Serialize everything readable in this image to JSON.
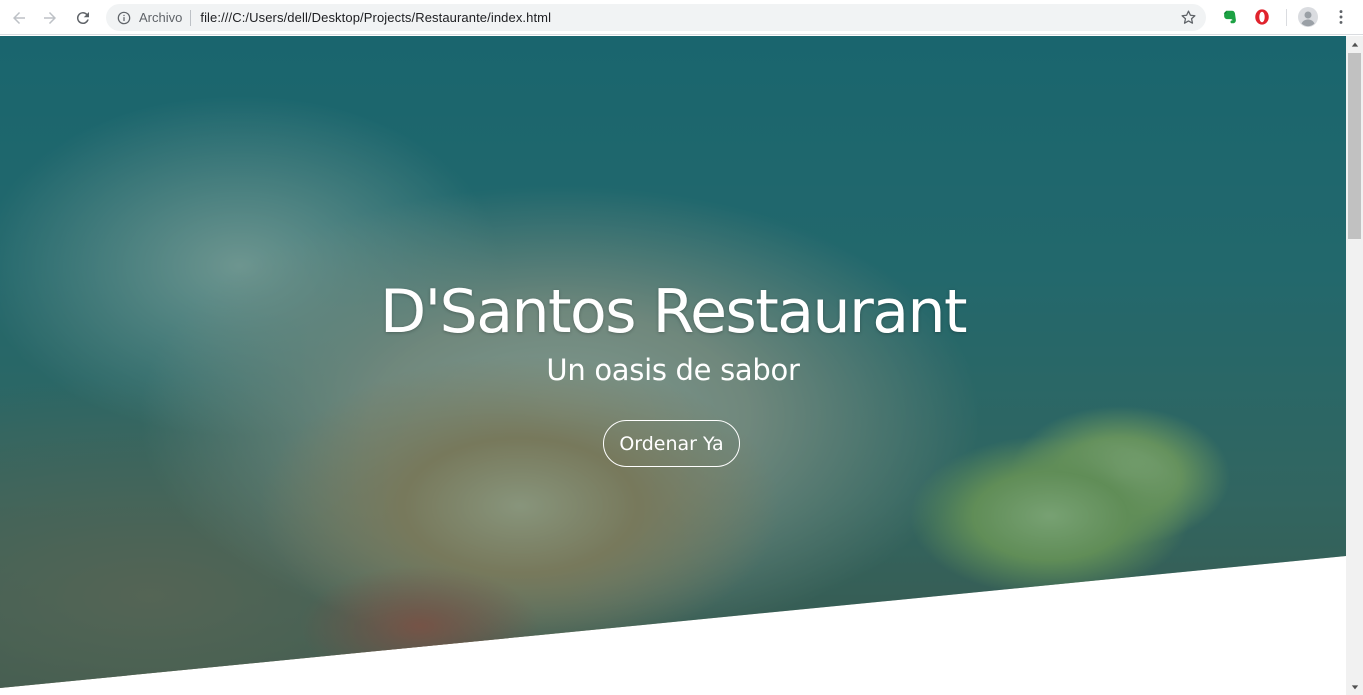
{
  "browser": {
    "scheme_label": "Archivo",
    "url": "file:///C:/Users/dell/Desktop/Projects/Restaurante/index.html",
    "icons": {
      "back": "back-arrow-icon",
      "forward": "forward-arrow-icon",
      "reload": "reload-icon",
      "info": "info-icon",
      "bookmark": "star-icon",
      "evernote": "evernote-icon",
      "opera": "opera-icon",
      "profile": "profile-icon",
      "menu": "menu-dots-icon"
    }
  },
  "hero": {
    "title": "D'Santos Restaurant",
    "subtitle": "Un oasis de sabor",
    "cta_label": "Ordenar Ya",
    "overlay_color": "#145f69"
  },
  "colors": {
    "accent_text": "#ffffff",
    "overlay": "#145f69"
  }
}
